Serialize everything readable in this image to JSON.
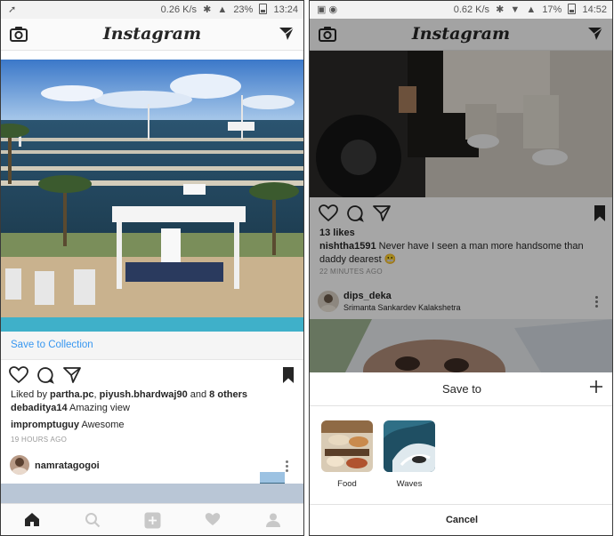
{
  "left_screen": {
    "status": {
      "speed": "0.26 K/s",
      "battery": "23%",
      "time": "13:24"
    },
    "app_title": "Instagram",
    "save_to_collection": "Save to Collection",
    "likes_prefix": "Liked by ",
    "likers": [
      "partha.pc",
      "piyush.bhardwaj90"
    ],
    "likes_and": " and ",
    "likes_others": "8 others",
    "caption": {
      "user": "debaditya14",
      "text": "Amazing view"
    },
    "comment": {
      "user": "impromptuguy",
      "text": "Awesome"
    },
    "post_time": "19 HOURS AGO",
    "next_post_user": "namratagogoi",
    "nav_icons": [
      "home-icon",
      "search-icon",
      "add-icon",
      "heart-icon",
      "profile-icon"
    ]
  },
  "right_screen": {
    "status": {
      "speed": "0.62 K/s",
      "battery": "17%",
      "time": "14:52"
    },
    "app_title": "Instagram",
    "likes": "13 likes",
    "caption": {
      "user": "nishtha1591",
      "text": "Never have I seen a man more handsome than daddy dearest 😬"
    },
    "post_time": "22 MINUTES AGO",
    "next_post": {
      "user": "dips_deka",
      "location": "Srimanta Sankardev Kalakshetra"
    },
    "sheet": {
      "title": "Save to",
      "collections": [
        {
          "name": "Food"
        },
        {
          "name": "Waves"
        }
      ],
      "cancel": "Cancel"
    }
  },
  "colors": {
    "link_blue": "#3897f0",
    "text": "#262626",
    "muted": "#999999"
  }
}
